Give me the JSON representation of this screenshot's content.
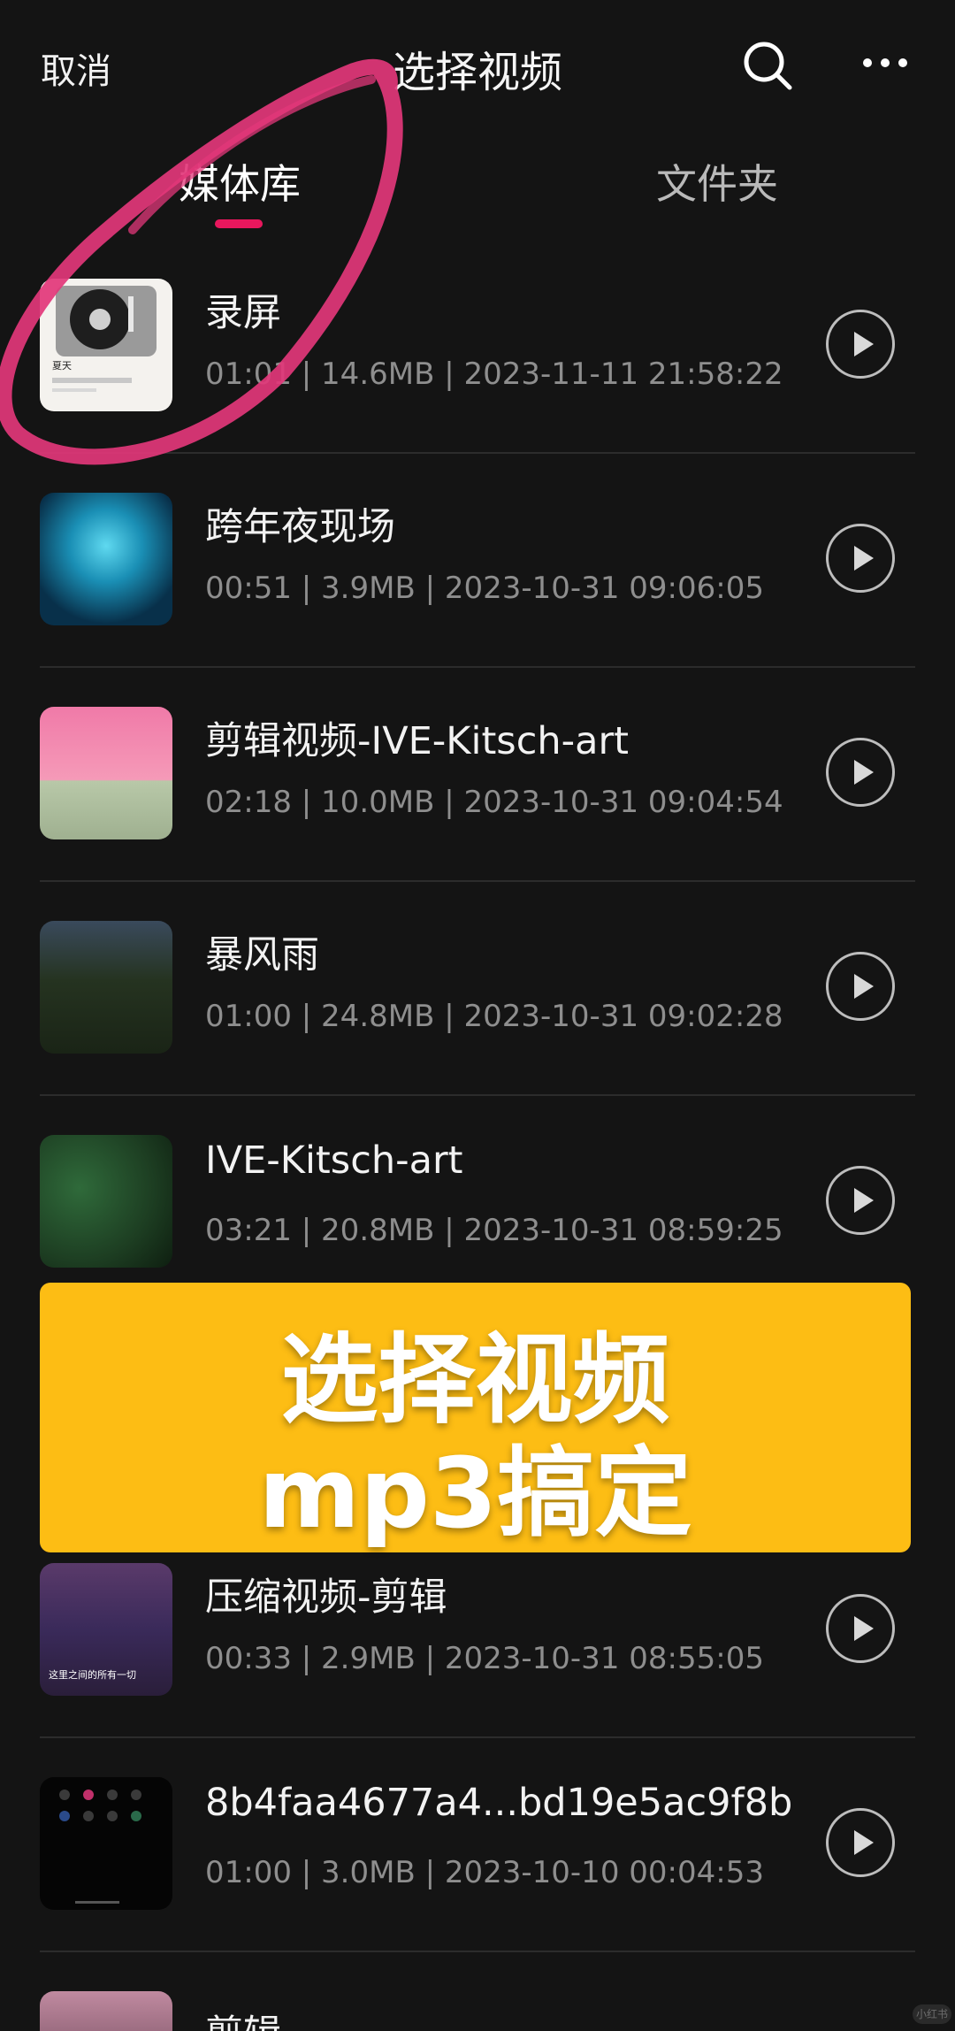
{
  "header": {
    "cancel_label": "取消",
    "title": "选择视频"
  },
  "tabs": [
    {
      "label": "媒体库",
      "active": true
    },
    {
      "label": "文件夹",
      "active": false
    }
  ],
  "accent_color": "#e8175d",
  "videos": [
    {
      "title": "录屏",
      "meta": "01:01 | 14.6MB | 2023-11-11 21:58:22"
    },
    {
      "title": "跨年夜现场",
      "meta": "00:51 | 3.9MB | 2023-10-31 09:06:05"
    },
    {
      "title": "剪辑视频-IVE-Kitsch-art",
      "meta": "02:18 | 10.0MB | 2023-10-31 09:04:54"
    },
    {
      "title": "暴风雨",
      "meta": "01:00 | 24.8MB | 2023-10-31 09:02:28"
    },
    {
      "title": "IVE-Kitsch-art",
      "meta": "03:21 | 20.8MB | 2023-10-31 08:59:25"
    },
    {
      "title": "压缩视频-剪辑",
      "meta": "00:33 | 2.9MB | 2023-10-31 08:55:05"
    },
    {
      "title": "8b4faa4677a4...bd19e5ac9f8b",
      "meta": "01:00 | 3.0MB | 2023-10-10 00:04:53"
    },
    {
      "title": "剪辑",
      "meta": ""
    }
  ],
  "thumbnail_texts": {
    "record_label": "夏天",
    "caption_6": "这里之间的所有一切"
  },
  "banner": {
    "line1": "选择视频",
    "line2": "mp3搞定",
    "color": "#fdbd14"
  },
  "watermark": "小红书"
}
